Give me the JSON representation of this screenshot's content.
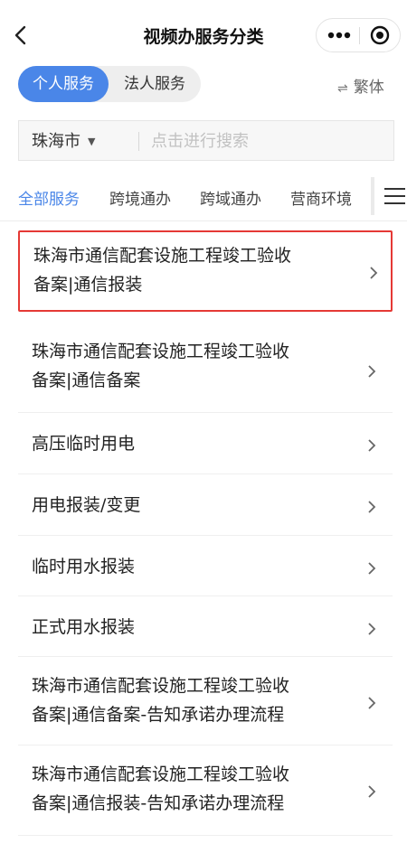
{
  "header": {
    "title": "视频办服务分类",
    "back_icon": "back-chevron-icon",
    "more_icon": "more-dots-icon",
    "close_icon": "miniprogram-close-icon"
  },
  "service_tabs": {
    "personal": "个人服务",
    "legal": "法人服务",
    "active": "personal"
  },
  "traditional": {
    "label": "繁体",
    "icon": "swap-icon"
  },
  "search": {
    "city": "珠海市",
    "placeholder": "点击进行搜索"
  },
  "categories": [
    {
      "label": "全部服务",
      "active": true
    },
    {
      "label": "跨境通办",
      "active": false
    },
    {
      "label": "跨域通办",
      "active": false
    },
    {
      "label": "营商环境",
      "active": false
    }
  ],
  "list": [
    {
      "lines": [
        "珠海市通信配套设施工程竣工验收",
        "备案|通信报装"
      ],
      "highlighted": true
    },
    {
      "lines": [
        "珠海市通信配套设施工程竣工验收",
        "备案|通信备案"
      ],
      "highlighted": false
    },
    {
      "lines": [
        "高压临时用电"
      ],
      "highlighted": false
    },
    {
      "lines": [
        "用电报装/变更"
      ],
      "highlighted": false
    },
    {
      "lines": [
        "临时用水报装"
      ],
      "highlighted": false
    },
    {
      "lines": [
        "正式用水报装"
      ],
      "highlighted": false
    },
    {
      "lines": [
        "珠海市通信配套设施工程竣工验收",
        "备案|通信备案-告知承诺办理流程"
      ],
      "highlighted": false
    },
    {
      "lines": [
        "珠海市通信配套设施工程竣工验收",
        "备案|通信报装-告知承诺办理流程"
      ],
      "highlighted": false
    }
  ],
  "colors": {
    "accent": "#4a86e8",
    "highlight_border": "#e53935"
  }
}
